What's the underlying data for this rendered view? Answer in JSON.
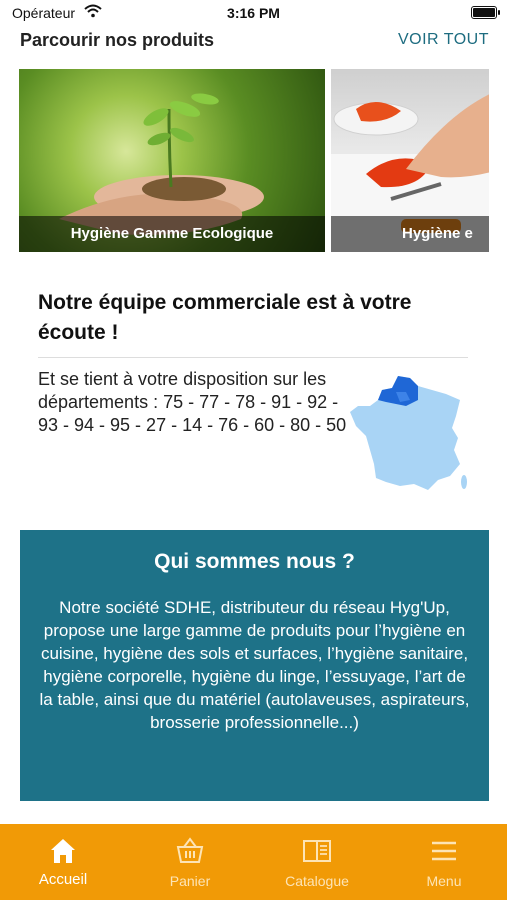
{
  "status_bar": {
    "carrier": "Opérateur",
    "time": "3:16 PM"
  },
  "browse": {
    "title": "Parcourir nos produits",
    "see_all": "VOIR TOUT",
    "cards": [
      {
        "label": "Hygiène Gamme Ecologique"
      },
      {
        "label": "Hygiène e"
      }
    ]
  },
  "team": {
    "title": "Notre équipe commerciale est à votre écoute !",
    "text": "Et se tient à votre disposition sur les départements : 75 - 77 - 78 - 91 - 92 - 93 - 94 - 95 - 27 - 14 - 76 - 60 - 80 - 50"
  },
  "about": {
    "title": "Qui sommes nous ?",
    "text": "Notre société SDHE, distributeur du réseau Hyg'Up, propose une large gamme de produits pour l’hygiène en cuisine, hygiène des sols et surfaces, l’hygiène sanitaire, hygiène corporelle, hygiène du linge, l’essuyage, l’art de la table, ainsi que du matériel (autolaveuses, aspirateurs, brosserie professionnelle...)"
  },
  "tabs": [
    {
      "label": "Accueil",
      "icon": "home-icon",
      "active": true
    },
    {
      "label": "Panier",
      "icon": "basket-icon",
      "active": false
    },
    {
      "label": "Catalogue",
      "icon": "book-icon",
      "active": false
    },
    {
      "label": "Menu",
      "icon": "menu-icon",
      "active": false
    }
  ],
  "colors": {
    "accent": "#1d6c80",
    "about_bg": "#1e7288",
    "tab_bar": "#f19a06",
    "map_light": "#a9d4f5",
    "map_dark": "#1f67d6"
  }
}
